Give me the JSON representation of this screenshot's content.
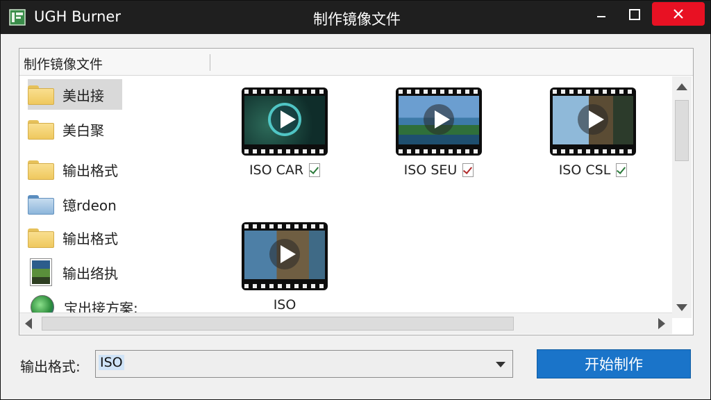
{
  "titlebar": {
    "app_name": "UGH Burner",
    "window_title": "制作镜像文件"
  },
  "browser": {
    "header_label": "制作镜像文件",
    "tree": [
      {
        "label": "美出接",
        "icon": "folder-icon",
        "selected": true
      },
      {
        "label": "美白聚",
        "icon": "folder-icon"
      },
      {
        "label": "输出格式",
        "icon": "folder-icon"
      },
      {
        "label": "镱rdeon",
        "icon": "folder-blue-icon"
      },
      {
        "label": "输出格式",
        "icon": "folder-icon"
      },
      {
        "label": "输出络执",
        "icon": "image-file-icon"
      },
      {
        "label": "宝出接方案:",
        "icon": "globe-icon"
      }
    ],
    "files": [
      {
        "label": "ISO CAR"
      },
      {
        "label": "ISO SEU"
      },
      {
        "label": "ISO CSL"
      },
      {
        "label": "ISO"
      }
    ]
  },
  "footer": {
    "format_label": "输出格式:",
    "format_value": "ISO",
    "start_button": "开始制作"
  },
  "colors": {
    "close_button": "#e81123",
    "primary_button": "#1a74c9",
    "titlebar": "#1f1f1f"
  }
}
